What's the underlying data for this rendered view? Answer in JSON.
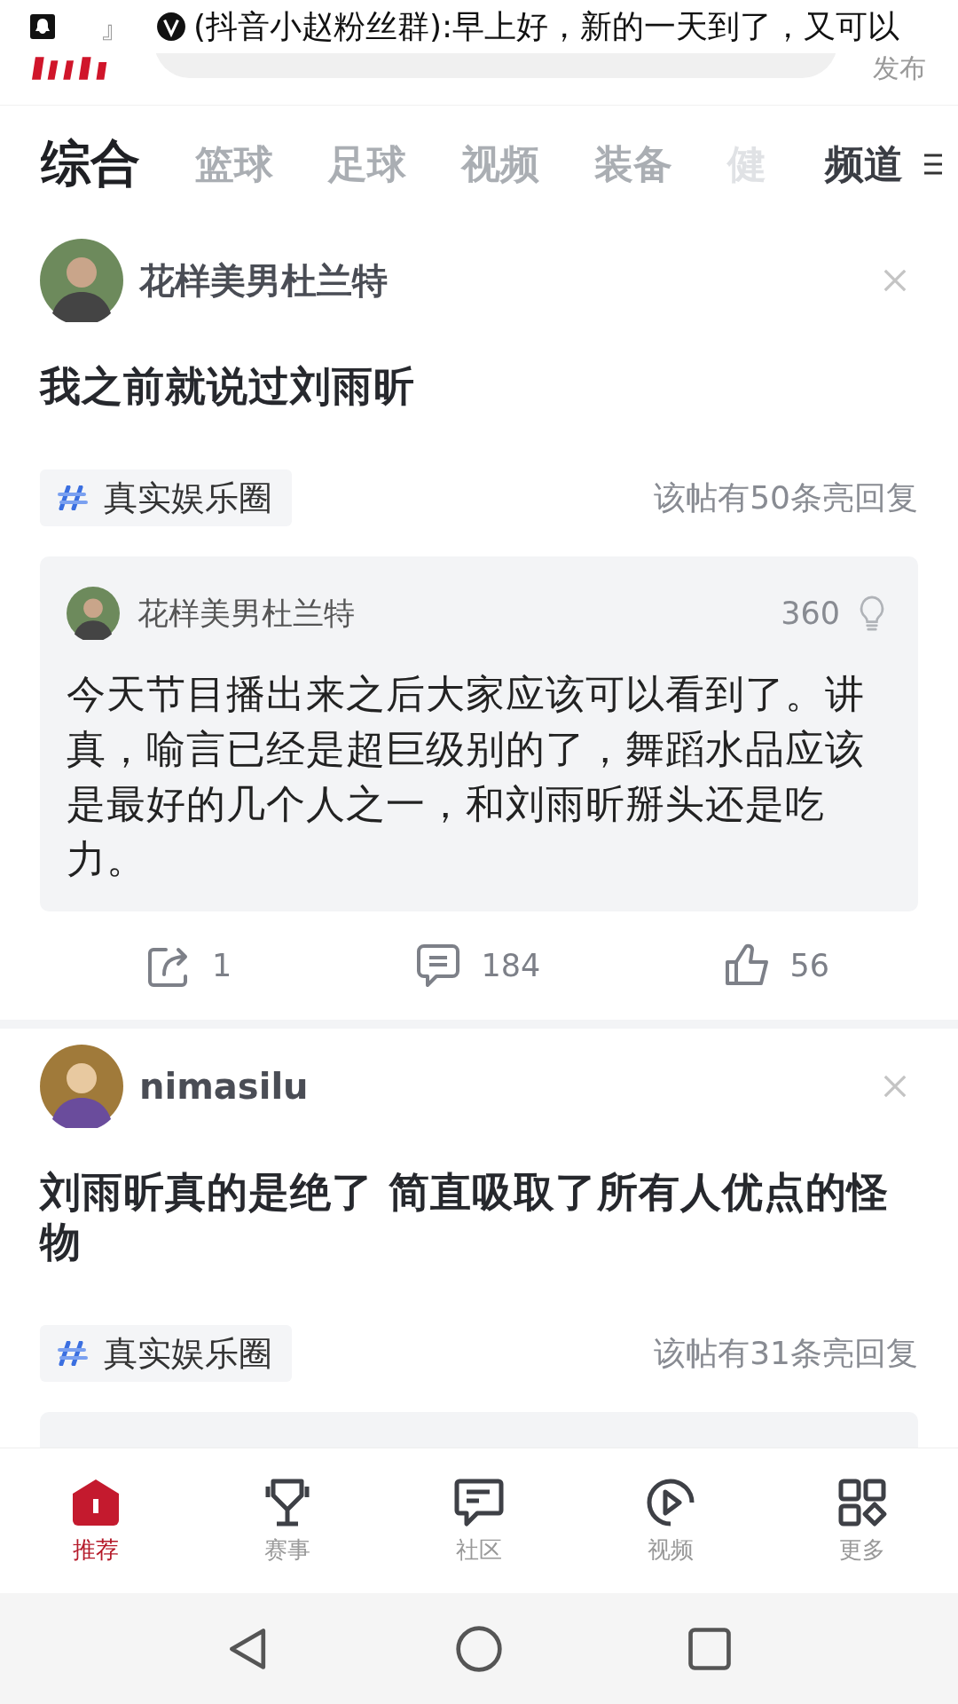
{
  "status_bar": {
    "message_prefix": "』",
    "message": "(抖音小赵粉丝群):早上好，新的一天到了，又可以"
  },
  "header": {
    "publish": "发布"
  },
  "tabs": [
    {
      "label": "综合",
      "selected": true,
      "faded": false
    },
    {
      "label": "篮球",
      "selected": false,
      "faded": false
    },
    {
      "label": "足球",
      "selected": false,
      "faded": false
    },
    {
      "label": "视频",
      "selected": false,
      "faded": false
    },
    {
      "label": "装备",
      "selected": false,
      "faded": false
    },
    {
      "label": "健",
      "selected": false,
      "faded": true
    }
  ],
  "channels_button": "频道",
  "posts": [
    {
      "author": "花样美男杜兰特",
      "title": "我之前就说过刘雨昕",
      "topic": "真实娱乐圈",
      "bright_replies": "该帖有50条亮回复",
      "quote": {
        "author": "花样美男杜兰特",
        "likes": "360",
        "text": "今天节目播出来之后大家应该可以看到了。讲真，喻言已经是超巨级别的了，舞蹈水品应该是最好的几个人之一，和刘雨昕掰头还是吃力。"
      },
      "actions": {
        "shares": "1",
        "comments": "184",
        "likes": "56"
      }
    },
    {
      "author": "nimasilu",
      "title": "刘雨昕真的是绝了 简直吸取了所有人优点的怪物",
      "topic": "真实娱乐圈",
      "bright_replies": "该帖有31条亮回复",
      "quote_preview": true
    }
  ],
  "bottom_nav": [
    {
      "label": "推荐",
      "selected": true
    },
    {
      "label": "赛事",
      "selected": false
    },
    {
      "label": "社区",
      "selected": false
    },
    {
      "label": "视频",
      "selected": false
    },
    {
      "label": "更多",
      "selected": false
    }
  ]
}
